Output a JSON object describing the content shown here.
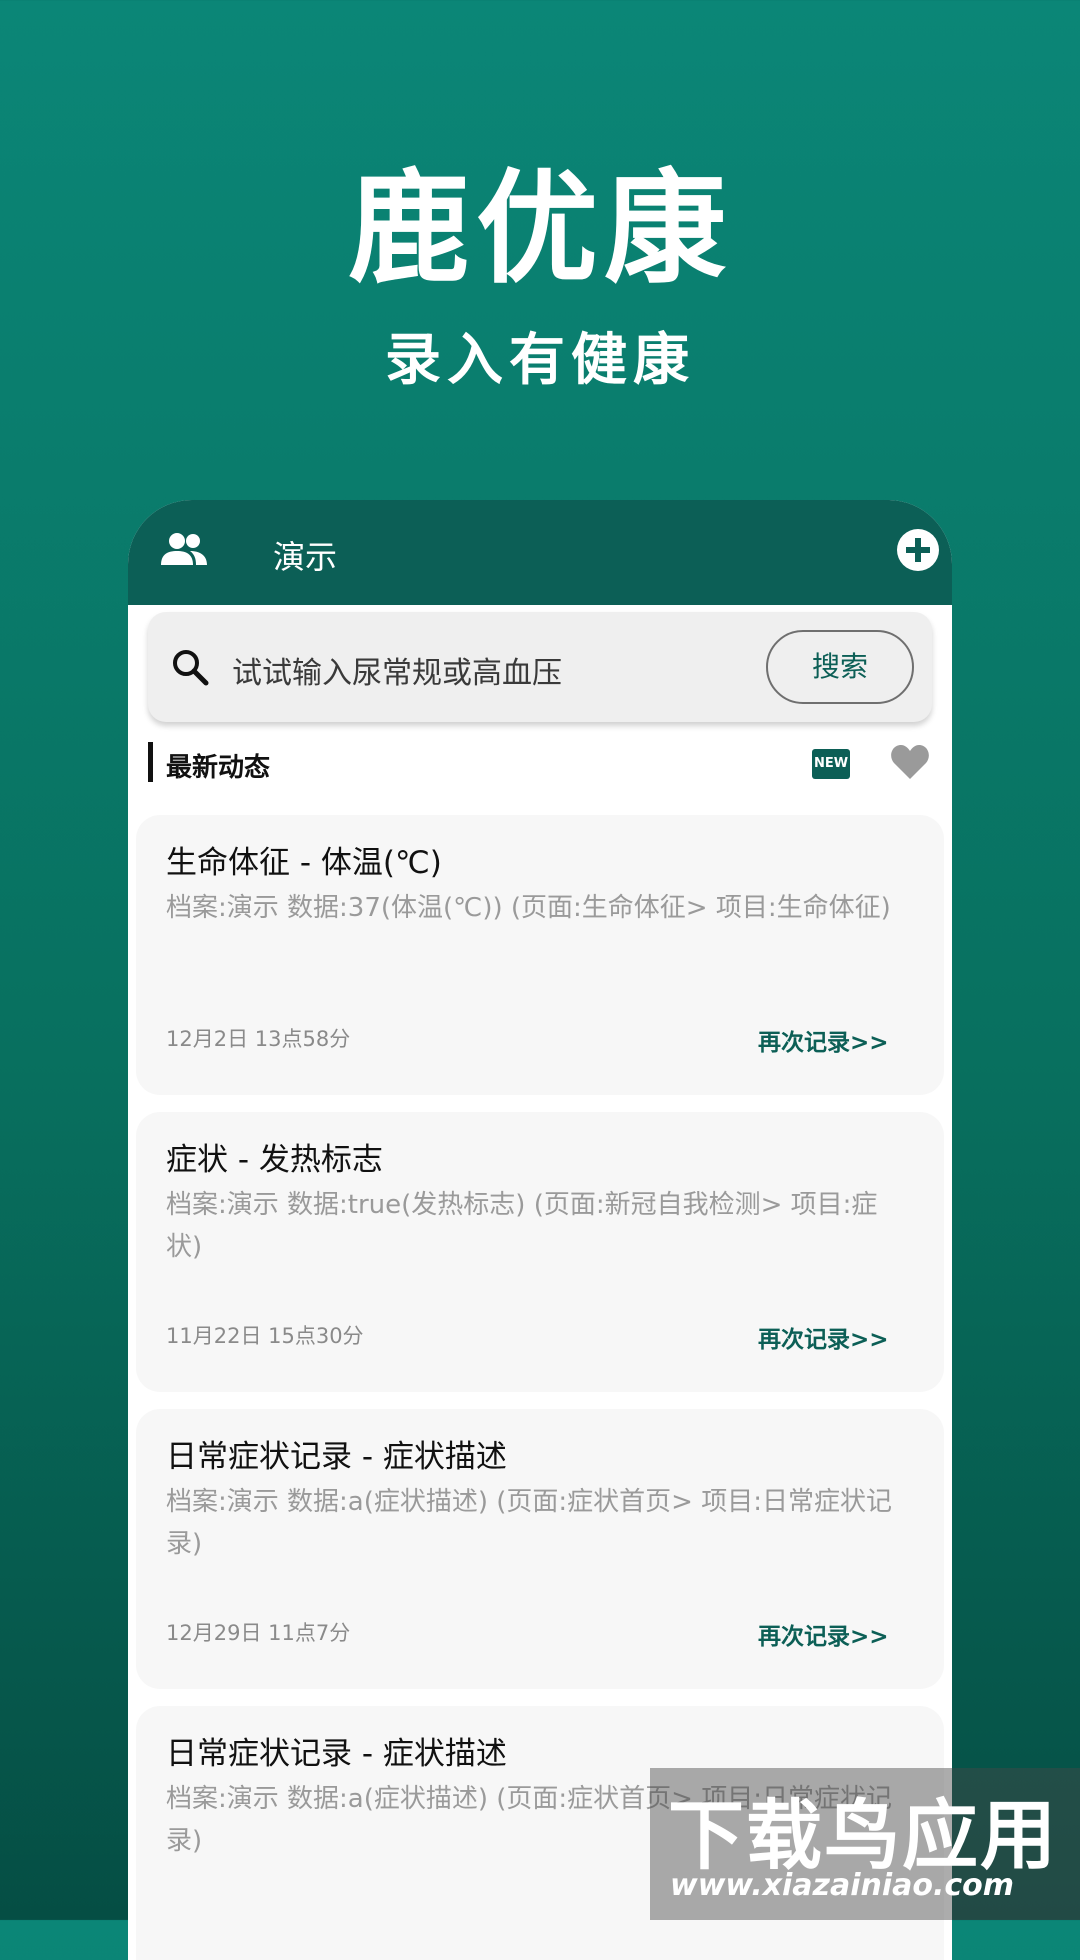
{
  "hero": {
    "title": "鹿优康",
    "subtitle": "录入有健康"
  },
  "header": {
    "title": "演示"
  },
  "search": {
    "placeholder": "试试输入尿常规或高血压",
    "button_label": "搜索"
  },
  "section": {
    "title": "最新动态",
    "badge": "NEW"
  },
  "cards": [
    {
      "title": "生命体征 - 体温(℃)",
      "desc": "档案:演示 数据:37(体温(℃)) (页面:生命体征> 项目:生命体征)",
      "time": "12月2日 13点58分",
      "action": "再次记录>>"
    },
    {
      "title": "症状 - 发热标志",
      "desc": "档案:演示 数据:true(发热标志) (页面:新冠自我检测> 项目:症状)",
      "time": "11月22日 15点30分",
      "action": "再次记录>>"
    },
    {
      "title": "日常症状记录 - 症状描述",
      "desc": "档案:演示 数据:a(症状描述) (页面:症状首页> 项目:日常症状记录)",
      "time": "12月29日 11点7分",
      "action": "再次记录>>"
    },
    {
      "title": "日常症状记录 - 症状描述",
      "desc": "档案:演示 数据:a(症状描述) (页面:症状首页> 项目:日常症状记录)",
      "time": "",
      "action": ""
    }
  ],
  "watermark": {
    "main": "下载鸟应用",
    "url": "www.xiazainiao.com"
  },
  "colors": {
    "brand": "#0c5f56",
    "background_top": "#0b8677",
    "background_bottom": "#054e44"
  }
}
